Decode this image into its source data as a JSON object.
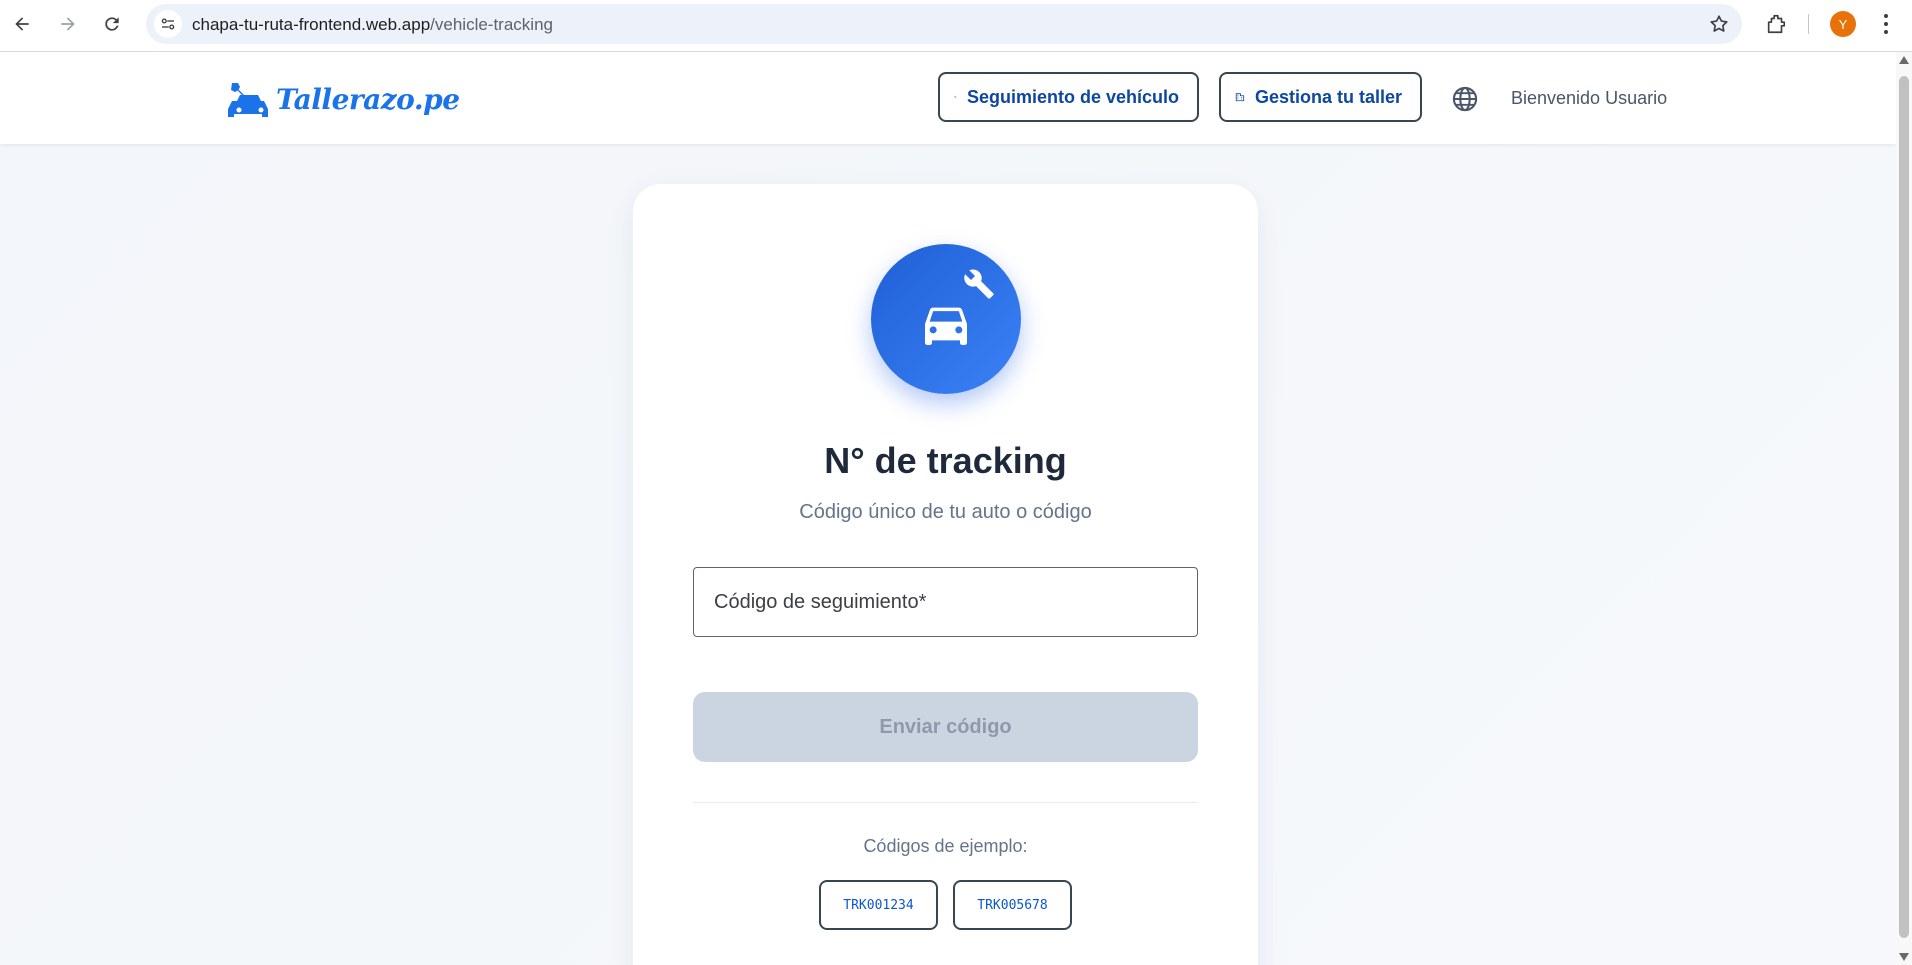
{
  "browser": {
    "url_host": "chapa-tu-ruta-frontend.web.app",
    "url_path": "/vehicle-tracking",
    "profile_initial": "Y",
    "icons": [
      "back-icon",
      "forward-icon",
      "reload-icon",
      "site-info-icon",
      "bookmark-star-icon",
      "extensions-icon",
      "more-menu-icon"
    ]
  },
  "header": {
    "logo_text": "Tallerazo.pe",
    "track_button": "Seguimiento de vehículo",
    "workshop_button": "Gestiona tu taller",
    "welcome": "Bienvenido Usuario"
  },
  "card": {
    "title": "N° de tracking",
    "subtitle": "Código único de tu auto o código",
    "input_placeholder": "Código de seguimiento*",
    "input_value": "",
    "submit_label": "Enviar código",
    "submit_disabled": true,
    "examples_label": "Códigos de ejemplo:",
    "examples": [
      "TRK001234",
      "TRK005678"
    ]
  },
  "colors": {
    "brand_blue": "#1a73e8",
    "hero_gradient_start": "#1f5fd6",
    "hero_gradient_end": "#3b82f6",
    "disabled_button": "#cbd5e1",
    "profile_avatar": "#e8710a"
  }
}
